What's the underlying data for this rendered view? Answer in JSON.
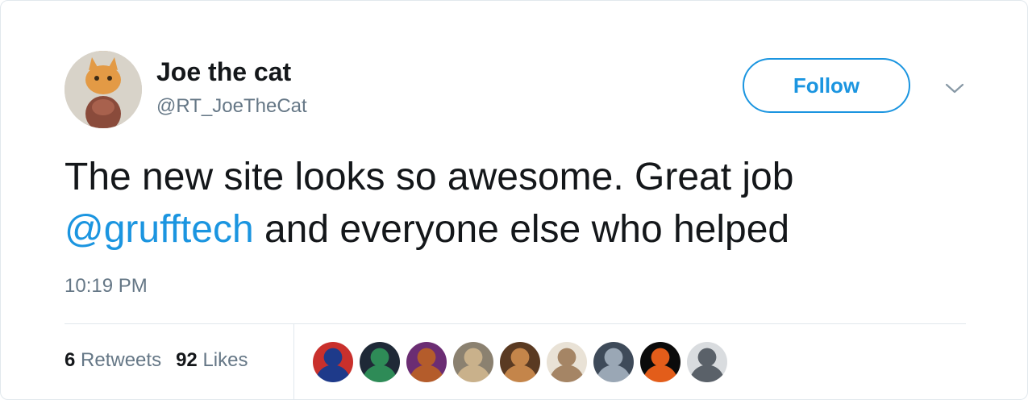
{
  "user": {
    "name": "Joe the cat",
    "handle": "@RT_JoeTheCat"
  },
  "follow_label": "Follow",
  "tweet": {
    "text_part1": "The new site looks so awesome. Great job ",
    "mention": "@grufftech",
    "text_part2": " and everyone else who helped",
    "time": "10:19 PM"
  },
  "stats": {
    "retweets_count": "6",
    "retweets_label": "Retweets",
    "likes_count": "92",
    "likes_label": "Likes"
  },
  "likers": [
    {
      "colors": [
        "#c9302c",
        "#1e3a8a"
      ]
    },
    {
      "colors": [
        "#1f2937",
        "#2e8b57"
      ]
    },
    {
      "colors": [
        "#6b2d73",
        "#b45c2b"
      ]
    },
    {
      "colors": [
        "#8b8170",
        "#c9b18b"
      ]
    },
    {
      "colors": [
        "#5a3a22",
        "#c4854a"
      ]
    },
    {
      "colors": [
        "#e9e2d6",
        "#a58565"
      ]
    },
    {
      "colors": [
        "#3e4a59",
        "#9aa7b5"
      ]
    },
    {
      "colors": [
        "#0b0b0b",
        "#e35d1a"
      ]
    },
    {
      "colors": [
        "#d9dcdf",
        "#5a6169"
      ]
    }
  ]
}
